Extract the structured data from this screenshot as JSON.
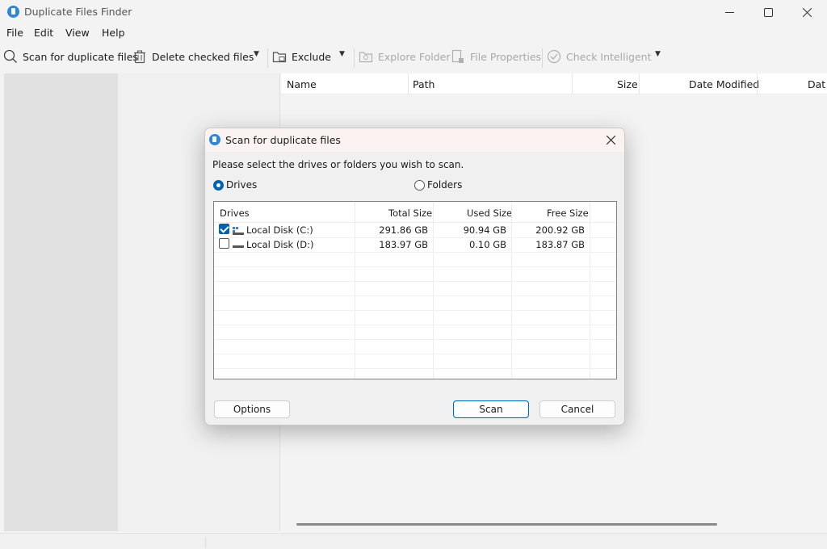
{
  "window": {
    "title": "Duplicate Files Finder",
    "minimize": "—",
    "maximize": "☐",
    "close": "✕"
  },
  "menu": {
    "items": [
      "File",
      "Edit",
      "View",
      "Help"
    ]
  },
  "toolbar": {
    "scan_label": "Scan for duplicate files",
    "delete_label": "Delete checked files",
    "exclude_label": "Exclude",
    "explore_label": "Explore Folder",
    "properties_label": "File Properties",
    "check_label": "Check Intelligent",
    "caret": "▼"
  },
  "file_list": {
    "columns": [
      "Name",
      "Path",
      "Size",
      "Date Modified",
      "Dat"
    ]
  },
  "dialog": {
    "title": "Scan for duplicate files",
    "close": "✕",
    "instruction": "Please select the drives or folders you wish to scan.",
    "radio_drives": "Drives",
    "radio_folders": "Folders",
    "selected_mode": "Drives",
    "table": {
      "headers": [
        "Drives",
        "Total Size",
        "Used Size",
        "Free Size"
      ],
      "rows": [
        {
          "name": "Local Disk (C:)",
          "total": "291.86 GB",
          "used": "90.94 GB",
          "free": "200.92 GB",
          "checked": true
        },
        {
          "name": "Local Disk (D:)",
          "total": "183.97 GB",
          "used": "0.10 GB",
          "free": "183.87 GB",
          "checked": false
        }
      ]
    },
    "options_label": "Options",
    "scan_label": "Scan",
    "cancel_label": "Cancel"
  },
  "colors": {
    "accent": "#0063b1",
    "app_icon": "#2f86d6",
    "disabled_text": "#a8a8a8"
  }
}
